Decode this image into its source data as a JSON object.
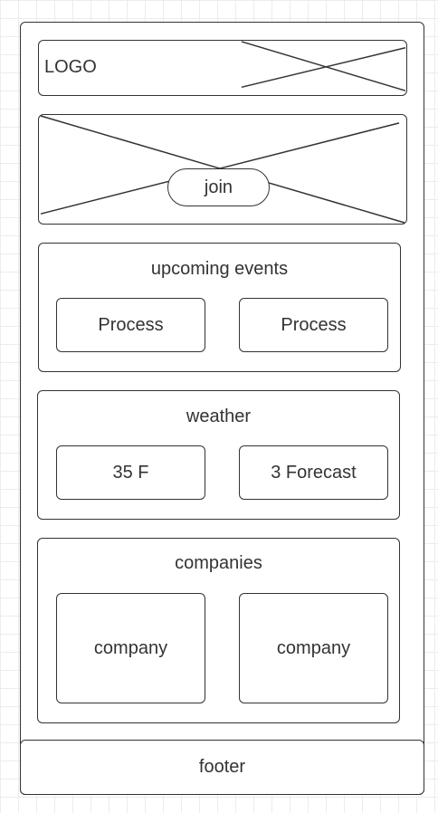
{
  "header": {
    "logo_text": "LOGO"
  },
  "hero": {
    "join_label": "join"
  },
  "upcoming_events": {
    "title": "upcoming events",
    "cards": [
      {
        "label": "Process"
      },
      {
        "label": "Process"
      }
    ]
  },
  "weather": {
    "title": "weather",
    "cards": [
      {
        "label": "35 F"
      },
      {
        "label": "3 Forecast"
      }
    ]
  },
  "companies": {
    "title": "companies",
    "cards": [
      {
        "label": "company"
      },
      {
        "label": "company"
      }
    ]
  },
  "footer": {
    "label": "footer"
  }
}
